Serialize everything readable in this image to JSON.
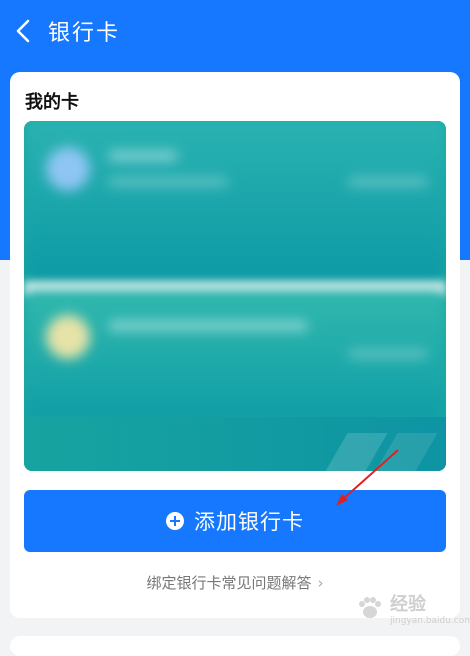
{
  "header": {
    "title": "银行卡",
    "back_icon": "chevron-left-icon"
  },
  "main": {
    "section_title": "我的卡",
    "add_card_label": "添加银行卡",
    "faq_label": "绑定银行卡常见问题解答"
  },
  "colors": {
    "primary": "#1677ff",
    "card_teal": "#12a0a4",
    "background": "#f2f3f5"
  },
  "watermark": {
    "brand": "经验",
    "url": "jingyan.baidu.com"
  }
}
